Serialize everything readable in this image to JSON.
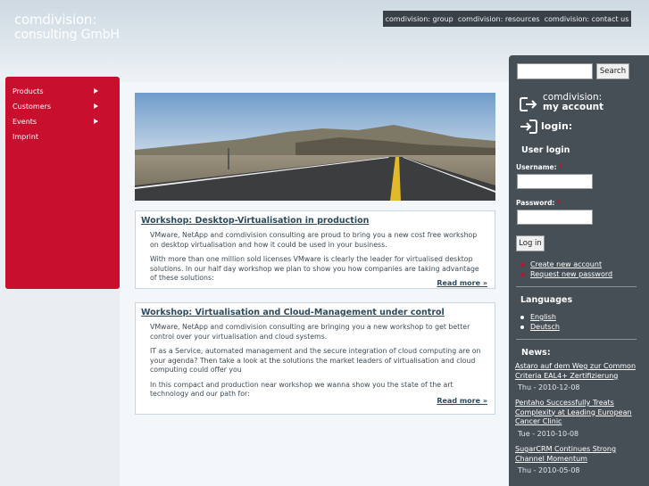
{
  "brand": {
    "logo_line1": "comdivision:",
    "logo_line2": "consulting GmbH"
  },
  "topnav": [
    {
      "label": "comdivision: group"
    },
    {
      "label": "comdivision: resources"
    },
    {
      "label": "comdivision: contact us"
    }
  ],
  "sidebar": {
    "items": [
      {
        "label": "Products",
        "has_submenu": true
      },
      {
        "label": "Customers",
        "has_submenu": true
      },
      {
        "label": "Events",
        "has_submenu": true
      },
      {
        "label": "Imprint",
        "has_submenu": false
      }
    ]
  },
  "articles": [
    {
      "title": "Workshop: Desktop-Virtualisation in production",
      "paragraphs": [
        "VMware, NetApp and comdivision consulting are proud to bring you a new cost free workshop on desktop virtualisation and how it could be used in your business.",
        "With more than one million sold licenses VMware is clearly the leader for virtualised desktop solutions. In our half day workshop we plan to show you how companies are taking advantage of these solutions:"
      ],
      "read_more": "Read more »"
    },
    {
      "title": "Workshop: Virtualisation and Cloud-Management under control",
      "paragraphs": [
        "VMware, NetApp and comdivision consulting are bringing you a new workshop to get better control over your virtualisation and cloud systems.",
        "IT as a Service, automated management and the secure integration of cloud computing are on your agenda? Then take a look at the solutions the market leaders of virtualisation and cloud computing could offer you",
        "In this compact and production near workshop we wanna show you the state of the art technology and our path for:"
      ],
      "read_more": "Read more »"
    }
  ],
  "search": {
    "placeholder": "",
    "button_label": "Search"
  },
  "account": {
    "line1": "comdivision:",
    "line2": "my account",
    "login_title": "login:"
  },
  "user_login": {
    "heading": "User login",
    "username_label": "Username:",
    "password_label": "Password:",
    "required_mark": "*",
    "button_label": "Log in",
    "links": [
      "Create new account",
      "Request new password"
    ]
  },
  "languages": {
    "heading": "Languages",
    "items": [
      "English",
      "Deutsch"
    ]
  },
  "news": {
    "heading": "News:",
    "items": [
      {
        "title": "Astaro auf dem Weg zur Common Criteria EAL4+ Zertifizierung",
        "date": "Thu - 2010-12-08"
      },
      {
        "title": "Pentaho Successfully Treats Complexity at Leading European Cancer Clinic",
        "date": "Tue - 2010-10-08"
      },
      {
        "title": "SugarCRM Continues Strong Channel Momentum",
        "date": "Thu - 2010-05-08"
      }
    ]
  },
  "colors": {
    "brand_red": "#c8102e",
    "dark_panel": "#464e56",
    "topnav_bg": "#3a4047",
    "link_blue": "#2d4a5e"
  }
}
